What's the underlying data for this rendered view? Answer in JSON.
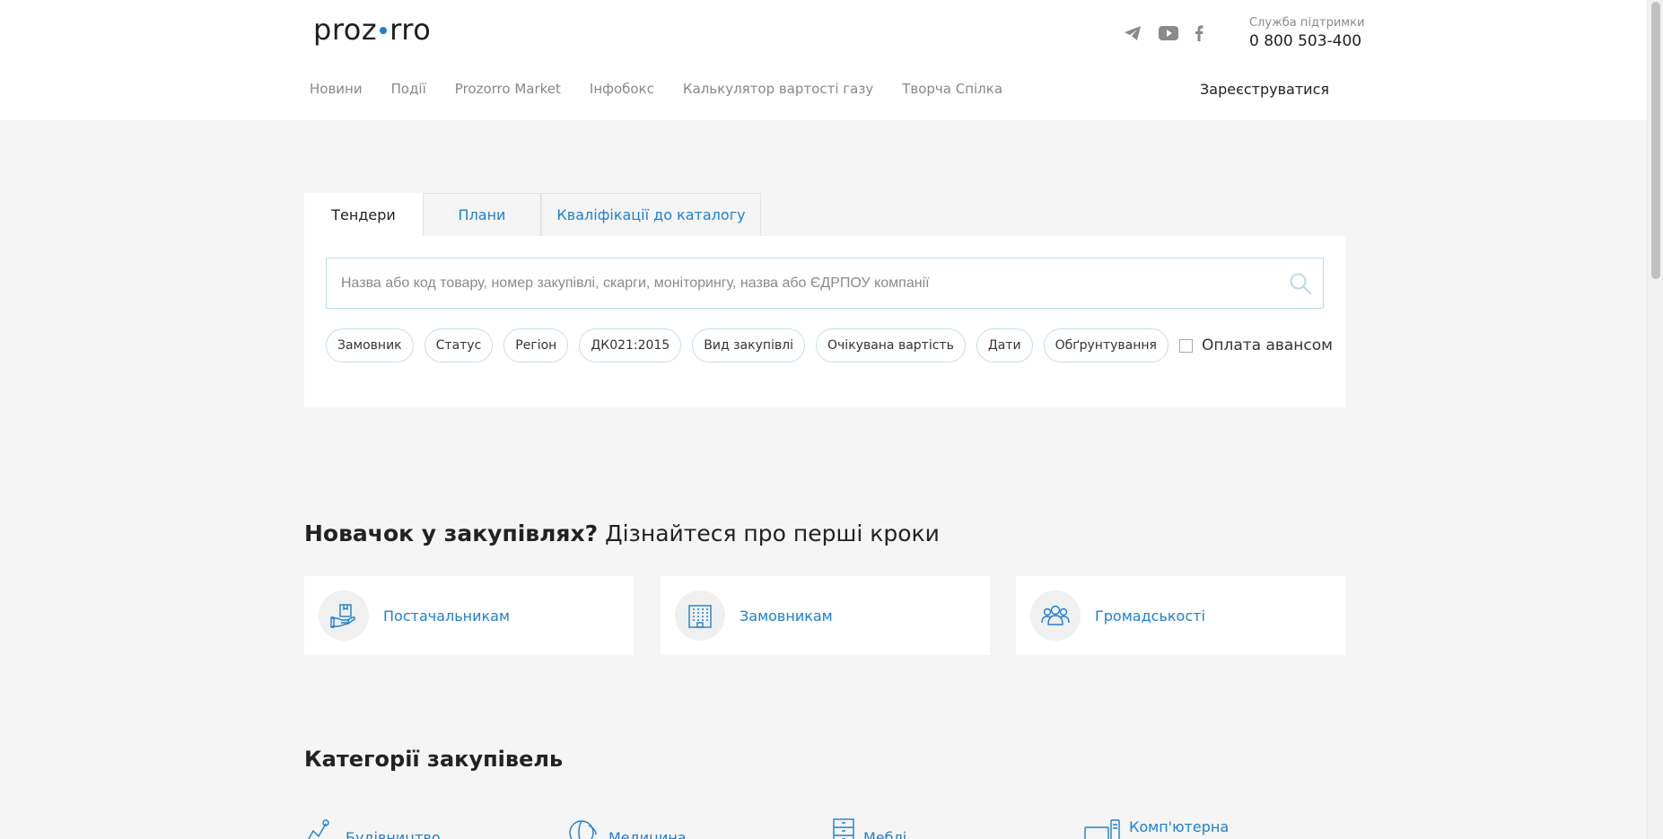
{
  "header": {
    "logo_left": "proz",
    "logo_right": "rro",
    "support_label": "Служба підтримки",
    "support_phone": "0 800 503-400",
    "social_icons": [
      "telegram-icon",
      "youtube-icon",
      "facebook-icon"
    ],
    "nav": [
      {
        "label": "Новини"
      },
      {
        "label": "Події"
      },
      {
        "label": "Prozorro Market"
      },
      {
        "label": "Інфобокс"
      },
      {
        "label": "Калькулятор вартості газу"
      },
      {
        "label": "Творча Спілка"
      }
    ],
    "register_label": "Зареєструватися"
  },
  "search": {
    "tabs": [
      {
        "label": "Тендери",
        "active": true
      },
      {
        "label": "Плани",
        "active": false
      },
      {
        "label": "Кваліфікації до каталогу",
        "active": false
      }
    ],
    "placeholder": "Назва або код товару, номер закупівлі, скарги, моніторингу, назва або ЄДРПОУ компанії",
    "value": "",
    "filters": [
      "Замовник",
      "Статус",
      "Регіон",
      "ДК021:2015",
      "Вид закупівлі",
      "Очікувана вартість",
      "Дати",
      "Обґрунтування"
    ],
    "advance_label": "Оплата авансом",
    "advance_checked": false
  },
  "newbie": {
    "title_bold": "Новачок у закупівлях?",
    "title_rest": "Дізнайтеся про перші кроки",
    "cards": [
      {
        "label": "Постачальникам",
        "icon": "box-hand-icon"
      },
      {
        "label": "Замовникам",
        "icon": "building-icon"
      },
      {
        "label": "Громадськості",
        "icon": "people-icon"
      }
    ]
  },
  "categories": {
    "title": "Категорії закупівель",
    "items": [
      {
        "label": "Будівництво",
        "icon": "construction-icon"
      },
      {
        "label": "Медицина",
        "icon": "medicine-icon"
      },
      {
        "label": "Меблі",
        "icon": "furniture-icon"
      },
      {
        "label": "Комп'ютерна",
        "icon": "computer-icon"
      }
    ]
  },
  "colors": {
    "accent": "#1e7fcf",
    "background": "#f5f5f5",
    "muted": "#888888"
  }
}
